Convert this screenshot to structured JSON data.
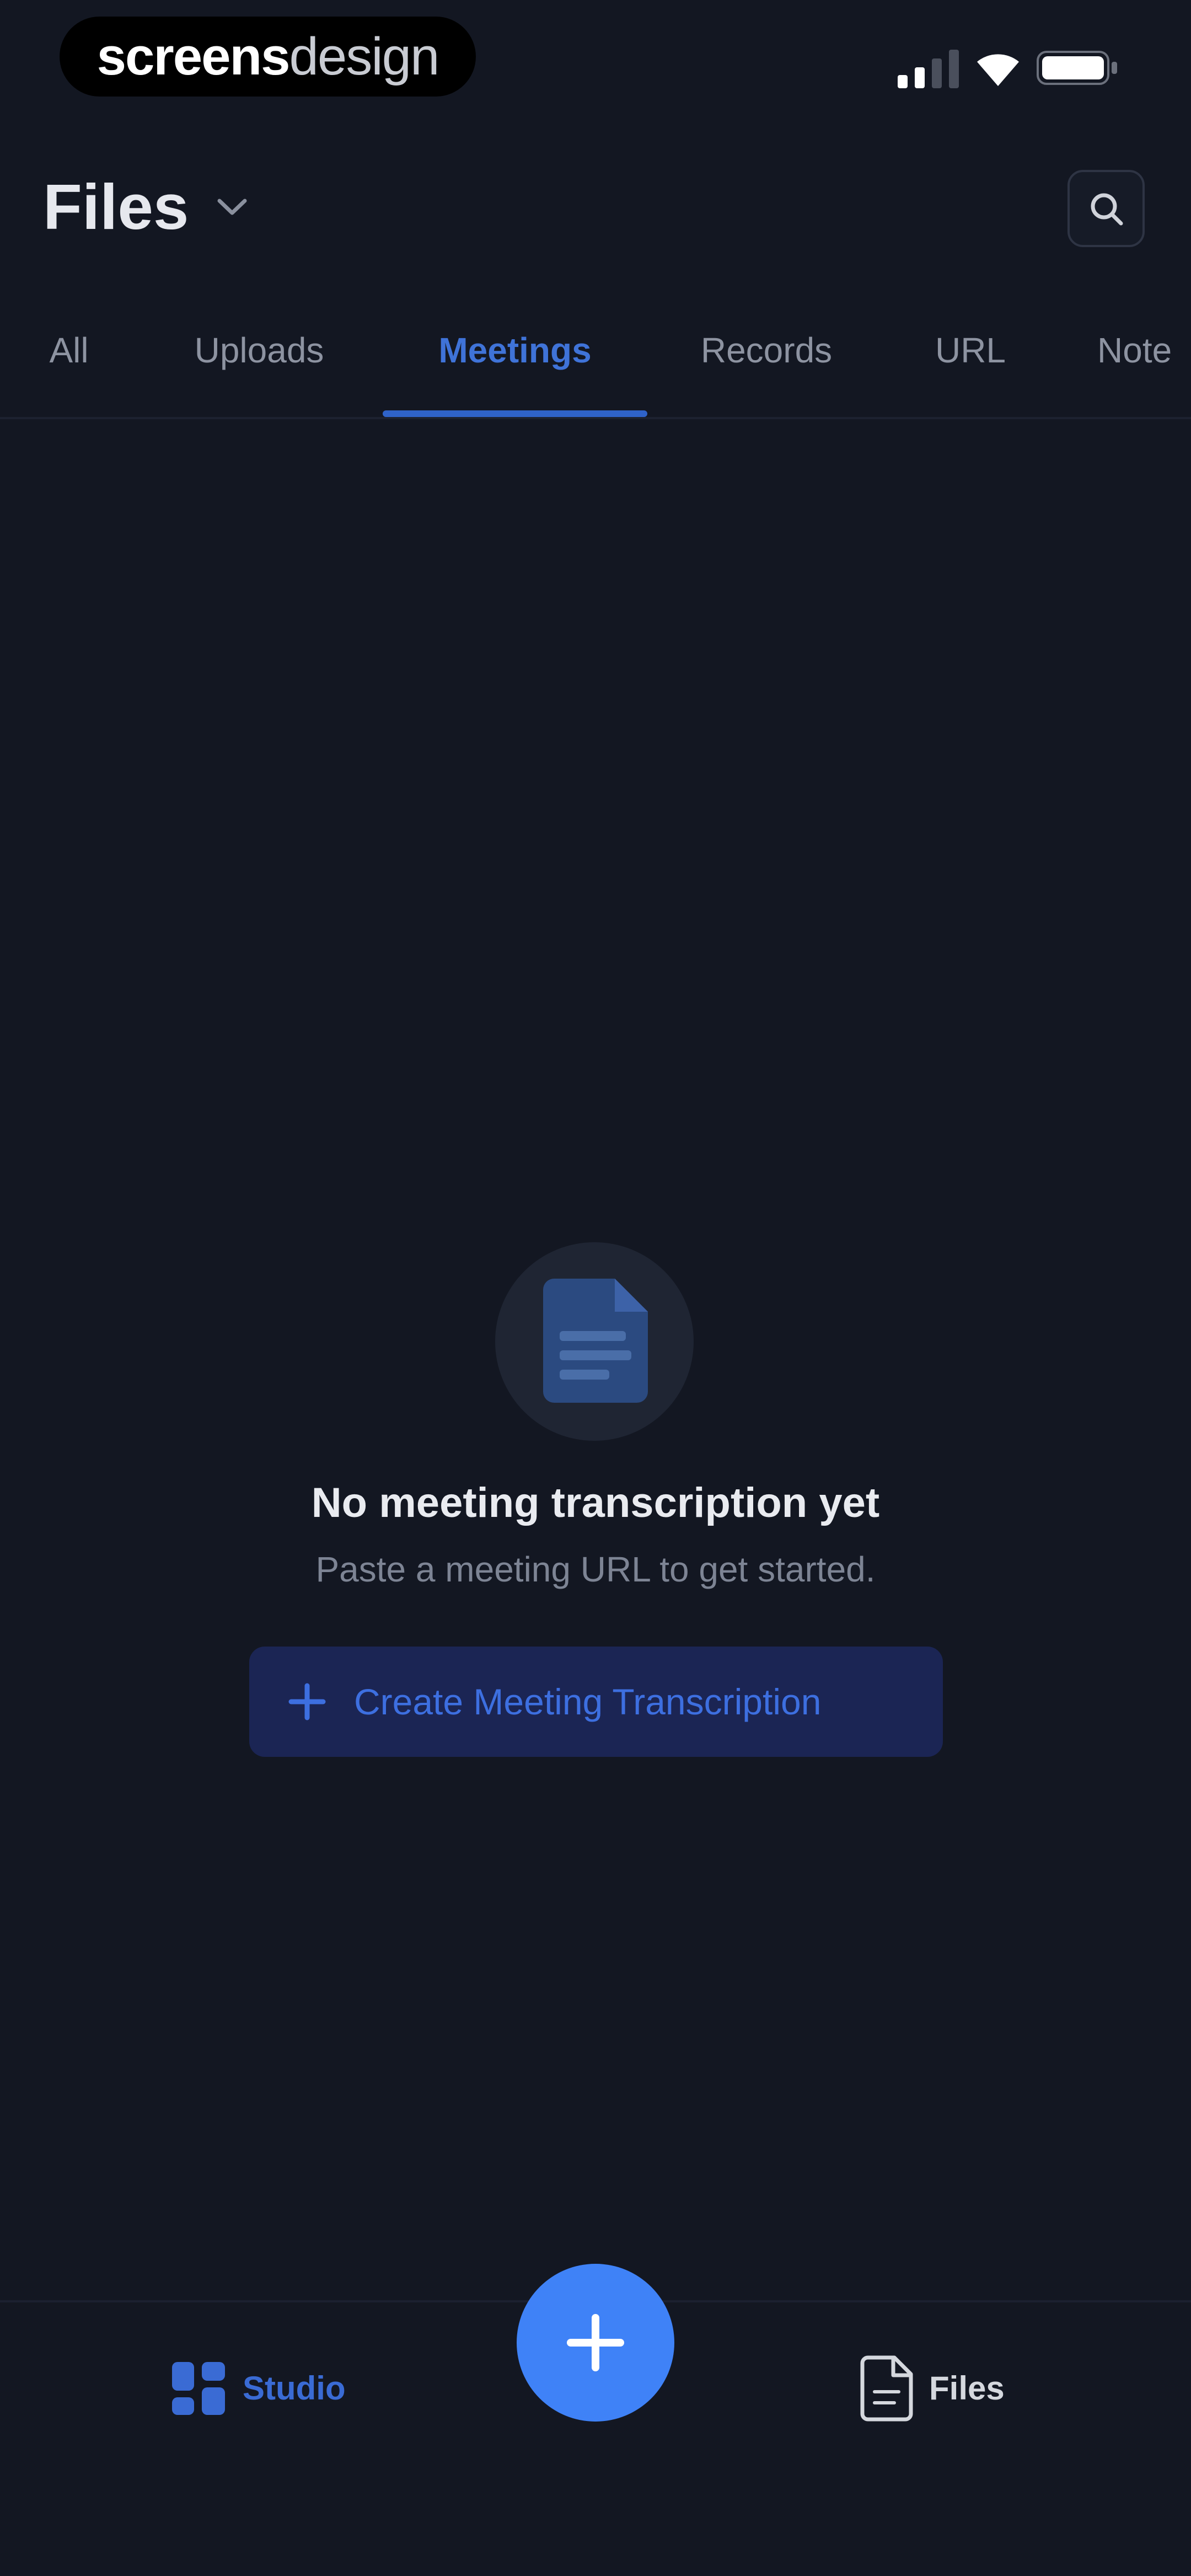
{
  "status_bar": {
    "brand_strong": "screens",
    "brand_light": "design",
    "icons": [
      "signal-icon",
      "wifi-icon",
      "battery-icon"
    ]
  },
  "header": {
    "title": "Files",
    "icons": [
      "chevron-down-icon",
      "search-icon"
    ]
  },
  "tabs": [
    {
      "label": "All"
    },
    {
      "label": "Uploads"
    },
    {
      "label": "Meetings",
      "active": true
    },
    {
      "label": "Records"
    },
    {
      "label": "URL"
    },
    {
      "label": "Note"
    }
  ],
  "empty_state": {
    "icon": "document-icon",
    "title": "No meeting transcription yet",
    "subtitle": "Paste a meeting URL to get started.",
    "button_label": "Create Meeting Transcription",
    "button_icon": "plus-icon"
  },
  "bottom_nav": {
    "studio_label": "Studio",
    "studio_icon": "grid-icon",
    "fab_icon": "plus-icon",
    "files_label": "Files",
    "files_icon": "file-icon"
  },
  "colors": {
    "background": "#131722",
    "accent": "#3f82f7",
    "active_tab": "#3f73d8",
    "text_muted": "#8d93a1"
  }
}
